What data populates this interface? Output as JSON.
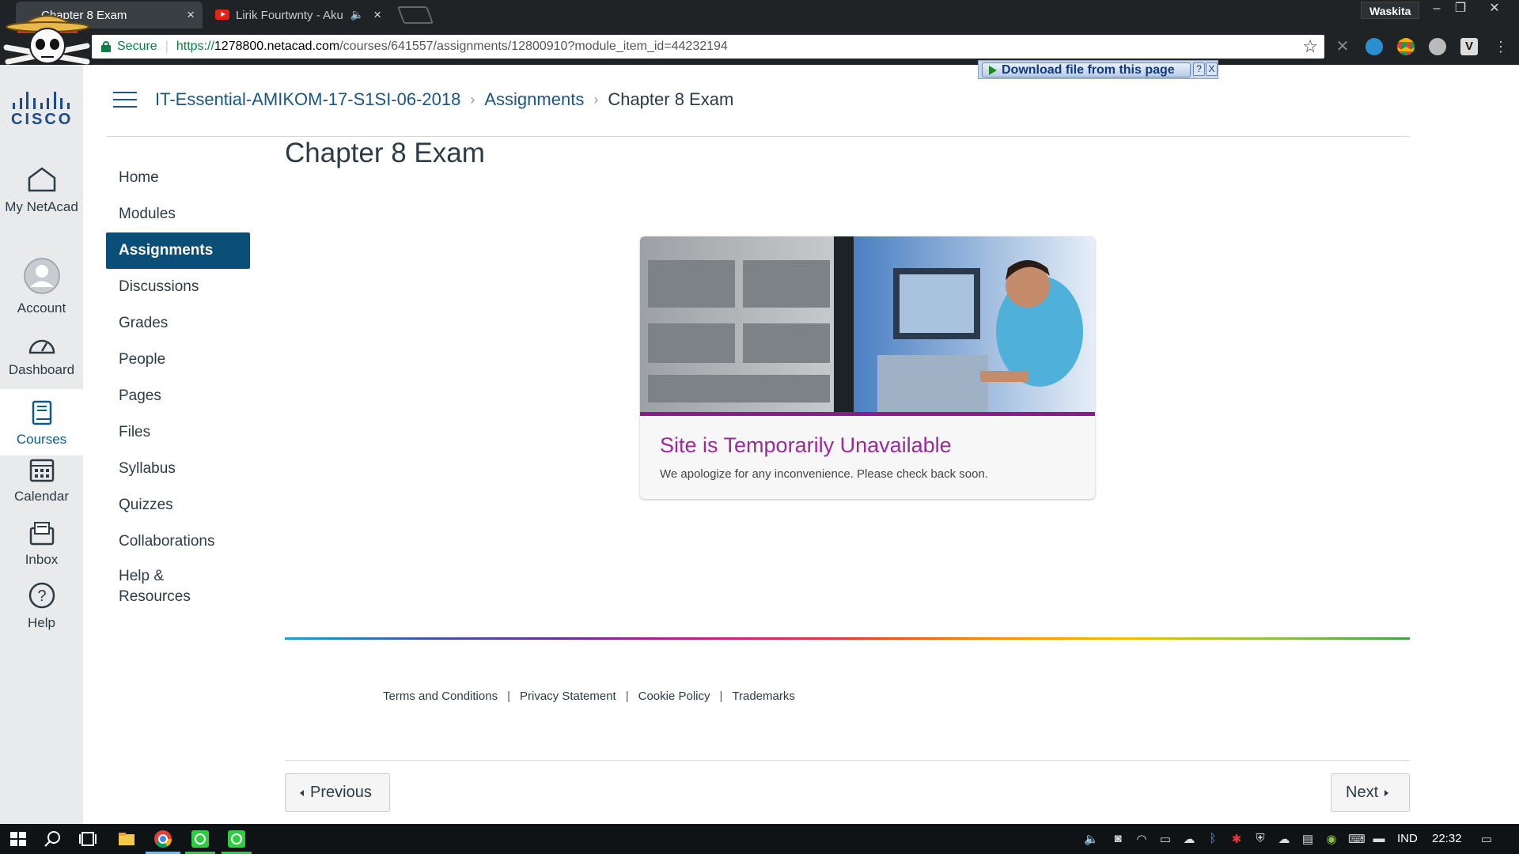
{
  "browser": {
    "tabs": [
      {
        "title": "Chapter 8 Exam",
        "active": true
      },
      {
        "title": "Lirik Fourtwnty - Aku",
        "active": false
      }
    ],
    "profile_name": "Waskita",
    "secure_label": "Secure",
    "url_scheme": "https://",
    "url_host": "1278800.netacad.com",
    "url_path": "/courses/641557/assignments/12800910?module_item_id=44232194",
    "download_button": "Download file from this page",
    "download_help": "?",
    "download_close": "X"
  },
  "global_nav": {
    "logo_text": "CISCO",
    "items": [
      {
        "label": "My NetAcad",
        "icon": "home-icon"
      },
      {
        "label": "Account",
        "icon": "avatar-icon"
      },
      {
        "label": "Dashboard",
        "icon": "dashboard-icon"
      },
      {
        "label": "Courses",
        "icon": "book-icon",
        "active": true
      },
      {
        "label": "Calendar",
        "icon": "calendar-icon"
      },
      {
        "label": "Inbox",
        "icon": "inbox-icon"
      },
      {
        "label": "Help",
        "icon": "help-icon"
      }
    ]
  },
  "breadcrumb": {
    "course": "IT-Essential-AMIKOM-17-S1SI-06-2018",
    "section": "Assignments",
    "current": "Chapter 8 Exam"
  },
  "course_nav": {
    "items": [
      {
        "label": "Home"
      },
      {
        "label": "Modules"
      },
      {
        "label": "Assignments",
        "active": true
      },
      {
        "label": "Discussions"
      },
      {
        "label": "Grades"
      },
      {
        "label": "People"
      },
      {
        "label": "Pages"
      },
      {
        "label": "Files"
      },
      {
        "label": "Syllabus"
      },
      {
        "label": "Quizzes"
      },
      {
        "label": "Collaborations"
      },
      {
        "label": "Help & Resources"
      }
    ]
  },
  "main": {
    "title": "Chapter 8 Exam",
    "card": {
      "title": "Site is Temporarily Unavailable",
      "message": "We apologize for any inconvenience. Please check back soon."
    }
  },
  "footer": {
    "links": [
      "Terms and Conditions",
      "Privacy Statement",
      "Cookie Policy",
      "Trademarks"
    ]
  },
  "pager": {
    "previous": "Previous",
    "next": "Next"
  },
  "taskbar": {
    "language": "IND",
    "time": "22:32"
  },
  "colors": {
    "brand_blue": "#0b4f79",
    "link_blue": "#1b5684",
    "card_title": "#9a2a9a",
    "secure_green": "#0b8043"
  }
}
